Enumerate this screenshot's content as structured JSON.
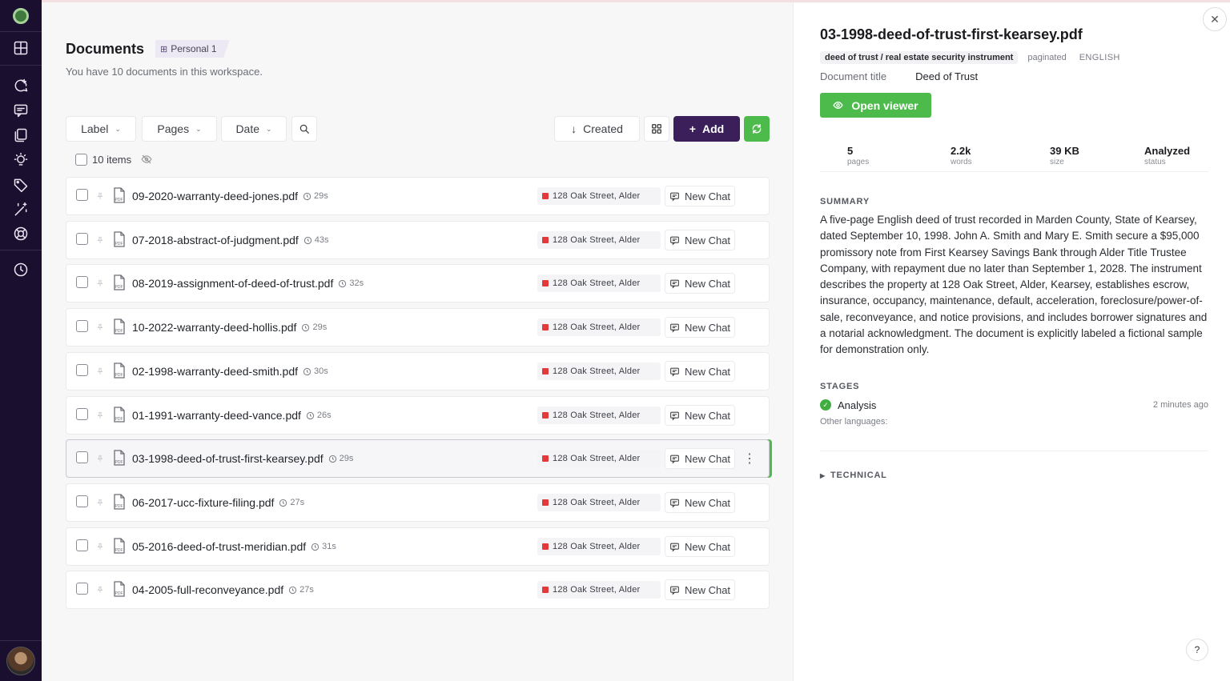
{
  "sidebar": {
    "items": [
      {
        "icon": "workspace-grid-icon"
      },
      {
        "icon": "new-chat-icon"
      },
      {
        "icon": "chats-icon"
      },
      {
        "icon": "documents-icon"
      },
      {
        "icon": "insights-bulb-icon"
      },
      {
        "icon": "labels-tag-icon"
      },
      {
        "icon": "magic-wand-icon"
      },
      {
        "icon": "help-lifebuoy-icon"
      },
      {
        "icon": "history-clock-icon"
      }
    ]
  },
  "header": {
    "title": "Documents",
    "workspace_badge": "Personal 1",
    "subtitle": "You have 10 documents in this workspace."
  },
  "toolbar": {
    "filters": [
      "Label",
      "Pages",
      "Date"
    ],
    "sort_label": "Created",
    "add_label": "Add",
    "items_count": "10 items"
  },
  "documents": [
    {
      "name": "09-2020-warranty-deed-jones.pdf",
      "age": "29s",
      "address": "128 Oak Street, Alder",
      "action": "New Chat"
    },
    {
      "name": "07-2018-abstract-of-judgment.pdf",
      "age": "43s",
      "address": "128 Oak Street, Alder",
      "action": "New Chat"
    },
    {
      "name": "08-2019-assignment-of-deed-of-trust.pdf",
      "age": "32s",
      "address": "128 Oak Street, Alder",
      "action": "New Chat"
    },
    {
      "name": "10-2022-warranty-deed-hollis.pdf",
      "age": "29s",
      "address": "128 Oak Street, Alder",
      "action": "New Chat"
    },
    {
      "name": "02-1998-warranty-deed-smith.pdf",
      "age": "30s",
      "address": "128 Oak Street, Alder",
      "action": "New Chat"
    },
    {
      "name": "01-1991-warranty-deed-vance.pdf",
      "age": "26s",
      "address": "128 Oak Street, Alder",
      "action": "New Chat"
    },
    {
      "name": "03-1998-deed-of-trust-first-kearsey.pdf",
      "age": "29s",
      "address": "128 Oak Street, Alder",
      "action": "New Chat"
    },
    {
      "name": "06-2017-ucc-fixture-filing.pdf",
      "age": "27s",
      "address": "128 Oak Street, Alder",
      "action": "New Chat"
    },
    {
      "name": "05-2016-deed-of-trust-meridian.pdf",
      "age": "31s",
      "address": "128 Oak Street, Alder",
      "action": "New Chat"
    },
    {
      "name": "04-2005-full-reconveyance.pdf",
      "age": "27s",
      "address": "128 Oak Street, Alder",
      "action": "New Chat"
    }
  ],
  "selected_index": 6,
  "panel": {
    "title": "03-1998-deed-of-trust-first-kearsey.pdf",
    "doc_type": "deed of trust / real estate security instrument",
    "layout": "paginated",
    "language": "ENGLISH",
    "meta_key": "Document title",
    "meta_value": "Deed of Trust",
    "open_viewer": "Open viewer",
    "stats": [
      {
        "value": "5",
        "label": "pages"
      },
      {
        "value": "2.2k",
        "label": "words"
      },
      {
        "value": "39 KB",
        "label": "size"
      },
      {
        "value": "Analyzed",
        "label": "status"
      }
    ],
    "summary_label": "SUMMARY",
    "summary": "A five-page English deed of trust recorded in Marden County, State of Kearsey, dated September 10, 1998. John A. Smith and Mary E. Smith secure a $95,000 promissory note from First Kearsey Savings Bank through Alder Title Trustee Company, with repayment due no later than September 1, 2028. The instrument describes the property at 128 Oak Street, Alder, Kearsey, establishes escrow, insurance, occupancy, maintenance, default, acceleration, foreclosure/power-of-sale, reconveyance, and notice provisions, and includes borrower signatures and a notarial acknowledgment. The document is explicitly labeled a fictional sample for demonstration only.",
    "stages_label": "STAGES",
    "stage_name": "Analysis",
    "stage_time": "2 minutes ago",
    "other_languages": "Other languages:",
    "technical_label": "TECHNICAL",
    "help": "?"
  },
  "colors": {
    "sidebar_bg": "#1a0f2e",
    "primary": "#3b1f5a",
    "accent_green": "#4cbb4c",
    "address_tag": "#e23a3a"
  }
}
